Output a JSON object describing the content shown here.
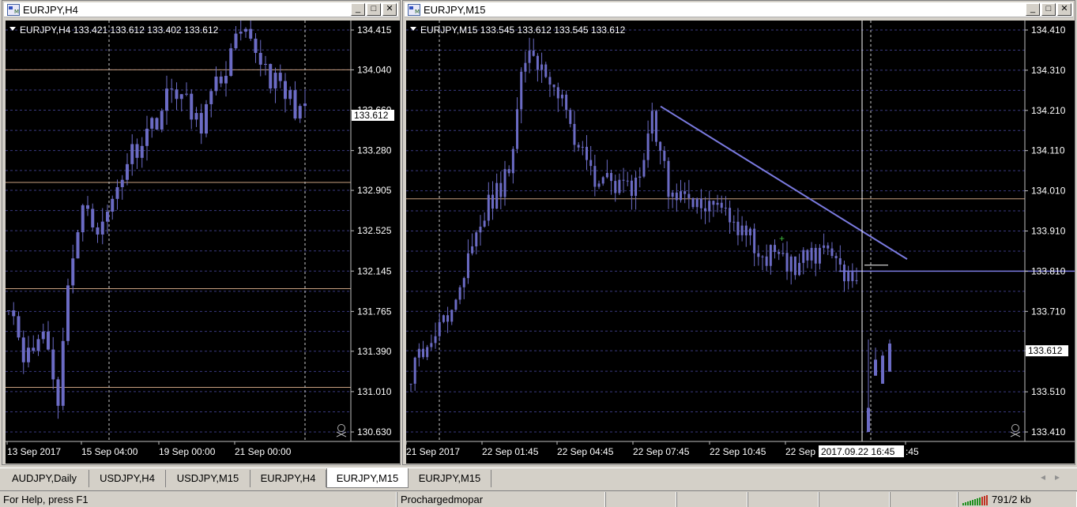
{
  "colors": {
    "candle": "#6b6bc4",
    "level": "#c8a080",
    "grid": "#3a3a80",
    "vline": "#c8c8c8",
    "trend": "#7a7adf",
    "axis_text": "#ffffff",
    "background": "#000000"
  },
  "icons": {
    "window": "chart-window-icon",
    "minimize": "minimize-icon",
    "maximize": "maximize-icon",
    "close": "close-icon",
    "skull": "skull-icon",
    "menu": "triangle-down-icon",
    "connection": "connection-bars-icon"
  },
  "windows": [
    {
      "title": "EURJPY,H4",
      "info": "EURJPY,H4  133.421 133.612 133.402 133.612",
      "price_labels": [
        "134.415",
        "134.040",
        "133.660",
        "133.280",
        "132.905",
        "132.525",
        "132.145",
        "131.765",
        "131.390",
        "131.010",
        "130.630"
      ],
      "current_price": "133.612",
      "time_labels": [
        "13 Sep 2017",
        "15 Sep 04:00",
        "19 Sep 00:00",
        "21 Sep 00:00"
      ],
      "level_prices": [
        134.04,
        132.98,
        131.98,
        131.05
      ]
    },
    {
      "title": "EURJPY,M15",
      "info": "EURJPY,M15  133.545 133.612 133.545 133.612",
      "price_labels": [
        "134.410",
        "134.310",
        "134.210",
        "134.110",
        "134.010",
        "133.910",
        "133.810",
        "133.710",
        "133.612",
        "133.510",
        "133.410"
      ],
      "current_price": "133.612",
      "time_labels": [
        "21 Sep 2017",
        "22 Sep 01:45",
        "22 Sep 04:45",
        "22 Sep 07:45",
        "22 Sep 10:45",
        "22 Sep",
        ":45"
      ],
      "crosshair_time": "2017.09.22 16:45",
      "level_prices": [
        133.99,
        133.81
      ]
    }
  ],
  "tabs": [
    "AUDJPY,Daily",
    "USDJPY,H4",
    "USDJPY,M15",
    "EURJPY,H4",
    "EURJPY,M15",
    "EURJPY,M15"
  ],
  "active_tab": 4,
  "status": {
    "help": "For Help, press F1",
    "profile": "Prochargedmopar",
    "traffic": "791/2 kb"
  }
}
